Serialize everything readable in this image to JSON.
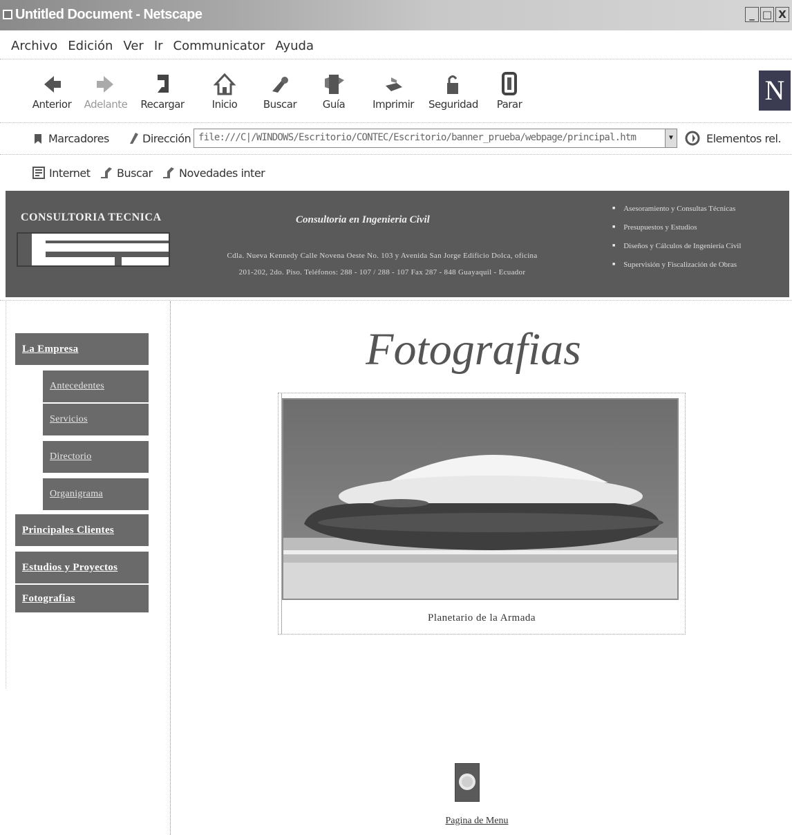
{
  "window": {
    "title": "Untitled Document - Netscape",
    "controls": [
      "_",
      "□",
      "X"
    ]
  },
  "menubar": {
    "items": [
      "Archivo",
      "Edición",
      "Ver",
      "Ir",
      "Communicator",
      "Ayuda"
    ]
  },
  "toolbar": {
    "buttons": [
      {
        "label": "Anterior",
        "icon": "back-arrow-icon"
      },
      {
        "label": "Adelante",
        "icon": "forward-arrow-icon"
      },
      {
        "label": "Recargar",
        "icon": "reload-icon"
      },
      {
        "label": "Inicio",
        "icon": "home-icon"
      },
      {
        "label": "Buscar",
        "icon": "search-icon"
      },
      {
        "label": "Guía",
        "icon": "guide-icon"
      },
      {
        "label": "Imprimir",
        "icon": "print-icon"
      },
      {
        "label": "Seguridad",
        "icon": "security-lock-icon"
      },
      {
        "label": "Parar",
        "icon": "stop-icon"
      }
    ],
    "logo": "N"
  },
  "location": {
    "bookmarks_label": "Marcadores",
    "address_label": "Dirección",
    "address_value": "file:///C|/WINDOWS/Escritorio/CONTEC/Escritorio/banner_prueba/webpage/principal.htm",
    "related_label": "Elementos rel."
  },
  "personal_toolbar": {
    "items": [
      "Internet",
      "Buscar",
      "Novedades inter"
    ]
  },
  "banner": {
    "brand": "CONSULTORIA TECNICA",
    "tagline": "Consultoria en Ingenieria Civil",
    "address_line1": "Cdla. Nueva Kennedy Calle Novena Oeste No. 103 y Avenida San Jorge Edificio Dolca, oficina",
    "address_line2": "201-202, 2do. Piso. Teléfonos: 288 - 107 / 288 - 107 Fax 287 - 848 Guayaquil - Ecuador",
    "services": [
      "Asesoramiento y Consultas Técnicas",
      "Presupuestos y Estudios",
      "Diseños y Cálculos de Ingeniería Civil",
      "Supervisión y Fiscalización de Obras"
    ]
  },
  "nav": {
    "la_empresa": "La Empresa",
    "antecedentes": "Antecedentes",
    "servicios": "Servicios",
    "directorio": "Directorio",
    "organigrama": "Organigrama",
    "principales_clientes": "Principales Clientes",
    "estudios_proyectos": "Estudios y Proyectos",
    "fotografias": "Fotografias"
  },
  "main": {
    "title": "Fotografias",
    "photo_caption": "Planetario de la Armada",
    "menu_link": "Pagina de Menu"
  },
  "colors": {
    "banner_bg": "#5a5a5a",
    "nav_button_bg": "#6a6a6a",
    "titlebar_start": "#8a8a8a"
  }
}
